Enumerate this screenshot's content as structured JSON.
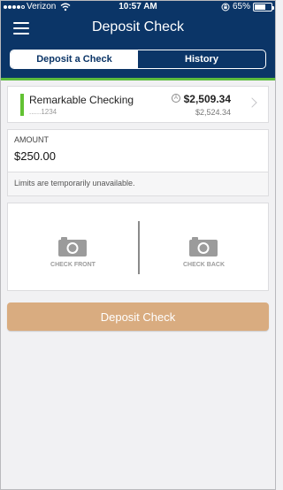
{
  "status_bar": {
    "carrier": "Verizon",
    "time": "10:57 AM",
    "battery_percent": "65%",
    "battery_level": 0.65,
    "icons": [
      "signal-dots",
      "wifi-icon",
      "rotation-lock-icon",
      "battery-icon"
    ]
  },
  "header": {
    "title": "Deposit Check",
    "menu_icon": "hamburger-menu-icon",
    "tabs": [
      {
        "label": "Deposit a Check",
        "active": true
      },
      {
        "label": "History",
        "active": false
      }
    ],
    "accent_color": "#5dbb3e",
    "background_color": "#0b3567"
  },
  "account": {
    "name": "Remarkable Checking",
    "number": "......1234",
    "available_balance": "$2,509.34",
    "available_icon_letter": "A",
    "current_balance": "$2,524.34",
    "indicator_color": "#62c233"
  },
  "amount": {
    "label": "AMOUNT",
    "value": "$250.00",
    "note": "Limits are temporarily unavailable."
  },
  "check_capture": {
    "front_label": "CHECK FRONT",
    "back_label": "CHECK BACK",
    "icon": "camera-icon"
  },
  "submit": {
    "label": "Deposit Check",
    "color": "#d9ac80"
  }
}
